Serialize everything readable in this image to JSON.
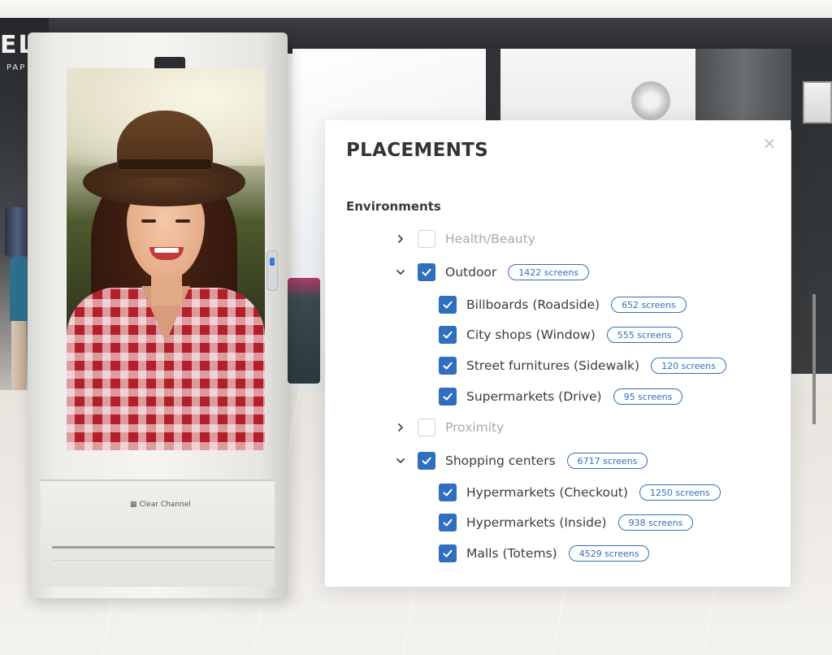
{
  "background": {
    "store_sign_text": "EL",
    "store_sign_sub": "PAP",
    "kiosk_brand": "Clear Channel"
  },
  "panel": {
    "title": "PLACEMENTS",
    "close_icon": "close-icon",
    "section_title": "Environments",
    "accent_color": "#2f6fbf",
    "categories": [
      {
        "label": "Health/Beauty",
        "badge": "",
        "checked": false,
        "expanded": false,
        "disabled": true,
        "children": []
      },
      {
        "label": "Outdoor",
        "badge": "1422 screens",
        "checked": true,
        "expanded": true,
        "disabled": false,
        "children": [
          {
            "label": "Billboards (Roadside)",
            "badge": "652 screens",
            "checked": true
          },
          {
            "label": "City shops (Window)",
            "badge": "555 screens",
            "checked": true
          },
          {
            "label": "Street furnitures (Sidewalk)",
            "badge": "120 screens",
            "checked": true
          },
          {
            "label": "Supermarkets (Drive)",
            "badge": "95 screens",
            "checked": true
          }
        ]
      },
      {
        "label": "Proximity",
        "badge": "",
        "checked": false,
        "expanded": false,
        "disabled": true,
        "children": []
      },
      {
        "label": "Shopping centers",
        "badge": "6717 screens",
        "checked": true,
        "expanded": true,
        "disabled": false,
        "children": [
          {
            "label": "Hypermarkets (Checkout)",
            "badge": "1250 screens",
            "checked": true
          },
          {
            "label": "Hypermarkets (Inside)",
            "badge": "938 screens",
            "checked": true
          },
          {
            "label": "Malls (Totems)",
            "badge": "4529 screens",
            "checked": true
          }
        ]
      }
    ]
  }
}
